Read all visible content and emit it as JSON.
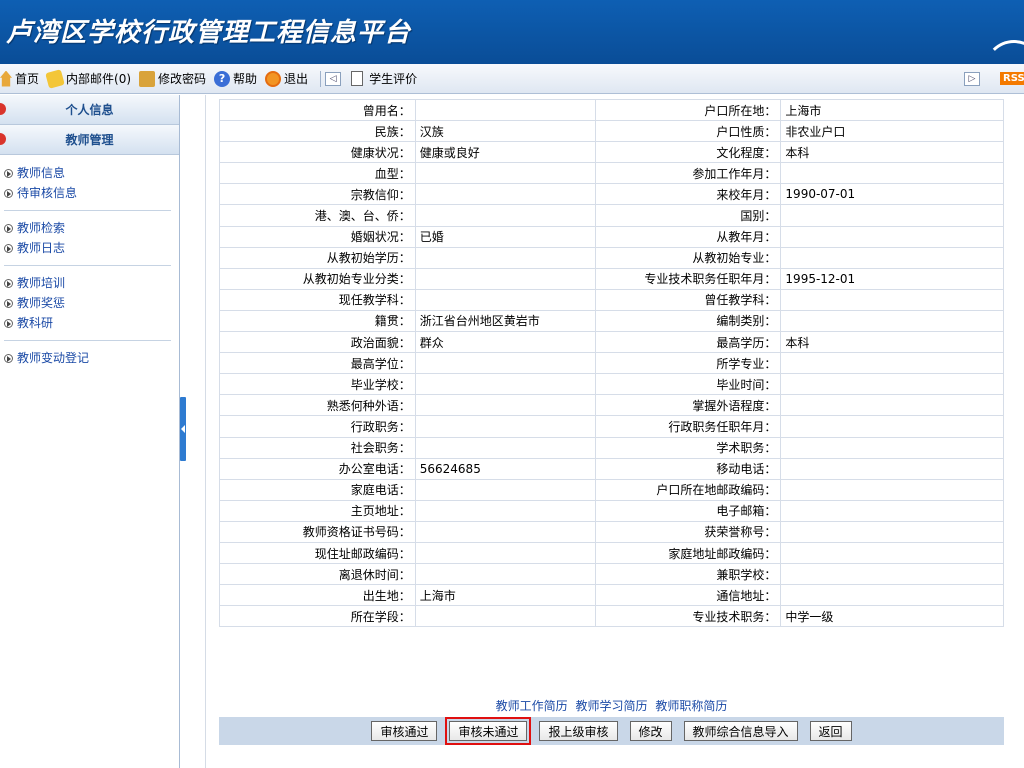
{
  "banner": {
    "title": "卢湾区学校行政管理工程信息平台"
  },
  "toolbar": {
    "home": "首页",
    "mail": "内部邮件(0)",
    "password": "修改密码",
    "help": "帮助",
    "exit": "退出",
    "tab": "学生评价",
    "rss": "RSS"
  },
  "sidebar": {
    "sections": [
      {
        "label": "个人信息"
      },
      {
        "label": "教师管理"
      }
    ],
    "group1": [
      {
        "label": "教师信息"
      },
      {
        "label": "待审核信息"
      }
    ],
    "group2": [
      {
        "label": "教师检索"
      },
      {
        "label": "教师日志"
      }
    ],
    "group3": [
      {
        "label": "教师培训"
      },
      {
        "label": "教师奖惩"
      },
      {
        "label": "教科研"
      }
    ],
    "group4": [
      {
        "label": "教师变动登记"
      }
    ]
  },
  "rows": [
    {
      "l1": "曾用名：",
      "v1": "",
      "l2": "户口所在地：",
      "v2": "上海市"
    },
    {
      "l1": "民族：",
      "v1": "汉族",
      "l2": "户口性质：",
      "v2": "非农业户口"
    },
    {
      "l1": "健康状况：",
      "v1": "健康或良好",
      "l2": "文化程度：",
      "v2": "本科"
    },
    {
      "l1": "血型：",
      "v1": "",
      "l2": "参加工作年月：",
      "v2": ""
    },
    {
      "l1": "宗教信仰：",
      "v1": "",
      "l2": "来校年月：",
      "v2": "1990-07-01"
    },
    {
      "l1": "港、澳、台、侨：",
      "v1": "",
      "l2": "国别：",
      "v2": ""
    },
    {
      "l1": "婚姻状况：",
      "v1": "已婚",
      "l2": "从教年月：",
      "v2": ""
    },
    {
      "l1": "从教初始学历：",
      "v1": "",
      "l2": "从教初始专业：",
      "v2": ""
    },
    {
      "l1": "从教初始专业分类：",
      "v1": "",
      "l2": "专业技术职务任职年月：",
      "v2": "1995-12-01"
    },
    {
      "l1": "现任教学科：",
      "v1": "",
      "l2": "曾任教学科：",
      "v2": ""
    },
    {
      "l1": "籍贯：",
      "v1": "浙江省台州地区黄岩市",
      "l2": "编制类别：",
      "v2": ""
    },
    {
      "l1": "政治面貌：",
      "v1": "群众",
      "l2": "最高学历：",
      "v2": "本科"
    },
    {
      "l1": "最高学位：",
      "v1": "",
      "l2": "所学专业：",
      "v2": ""
    },
    {
      "l1": "毕业学校：",
      "v1": "",
      "l2": "毕业时间：",
      "v2": ""
    },
    {
      "l1": "熟悉何种外语：",
      "v1": "",
      "l2": "掌握外语程度：",
      "v2": ""
    },
    {
      "l1": "行政职务：",
      "v1": "",
      "l2": "行政职务任职年月：",
      "v2": ""
    },
    {
      "l1": "社会职务：",
      "v1": "",
      "l2": "学术职务：",
      "v2": ""
    },
    {
      "l1": "办公室电话：",
      "v1": "56624685",
      "l2": "移动电话：",
      "v2": ""
    },
    {
      "l1": "家庭电话：",
      "v1": "",
      "l2": "户口所在地邮政编码：",
      "v2": ""
    },
    {
      "l1": "主页地址：",
      "v1": "",
      "l2": "电子邮箱：",
      "v2": ""
    },
    {
      "l1": "教师资格证书号码：",
      "v1": "",
      "l2": "获荣誉称号：",
      "v2": ""
    },
    {
      "l1": "现住址邮政编码：",
      "v1": "",
      "l2": "家庭地址邮政编码：",
      "v2": ""
    },
    {
      "l1": "离退休时间：",
      "v1": "",
      "l2": "兼职学校：",
      "v2": ""
    },
    {
      "l1": "出生地：",
      "v1": "上海市",
      "l2": "通信地址：",
      "v2": ""
    },
    {
      "l1": "所在学段：",
      "v1": "",
      "l2": "专业技术职务：",
      "v2": "中学一级"
    }
  ],
  "links": [
    "教师工作简历",
    "教师学习简历",
    "教师职称简历"
  ],
  "buttons": [
    "审核通过",
    "审核未通过",
    "报上级审核",
    "修改",
    "教师综合信息导入",
    "返回"
  ]
}
